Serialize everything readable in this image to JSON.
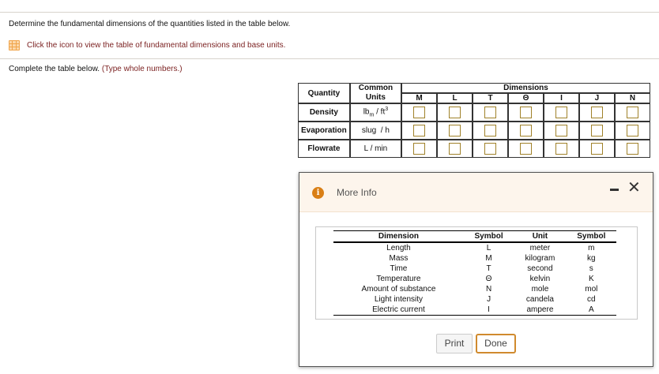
{
  "instructions": {
    "line1": "Determine the fundamental dimensions of the quantities listed in the table below.",
    "icon_link": "Click the icon to view the table of fundamental dimensions and base units.",
    "complete": "Complete the table below.",
    "hint": "(Type whole numbers.)"
  },
  "main_table": {
    "col_quantity": "Quantity",
    "col_units_1": "Common",
    "col_units_2": "Units",
    "col_dimensions": "Dimensions",
    "dims": [
      "M",
      "L",
      "T",
      "Θ",
      "I",
      "J",
      "N"
    ],
    "rows": [
      {
        "quantity": "Density",
        "unit_base": "lb",
        "unit_sub": "m",
        "unit_rest": " / ft",
        "unit_sup": "3"
      },
      {
        "quantity": "Evaporation",
        "unit": "slug  / h"
      },
      {
        "quantity": "Flowrate",
        "unit": "L / min"
      }
    ]
  },
  "dialog": {
    "title": "More Info",
    "info_icon": "i",
    "close_icon": "✕",
    "headers": [
      "Dimension",
      "Symbol",
      "Unit",
      "Symbol"
    ],
    "rows": [
      [
        "Length",
        "L",
        "meter",
        "m"
      ],
      [
        "Mass",
        "M",
        "kilogram",
        "kg"
      ],
      [
        "Time",
        "T",
        "second",
        "s"
      ],
      [
        "Temperature",
        "Θ",
        "kelvin",
        "K"
      ],
      [
        "Amount of substance",
        "N",
        "mole",
        "mol"
      ],
      [
        "Light intensity",
        "J",
        "candela",
        "cd"
      ],
      [
        "Electric current",
        "I",
        "ampere",
        "A"
      ]
    ],
    "print_label": "Print",
    "done_label": "Done"
  }
}
